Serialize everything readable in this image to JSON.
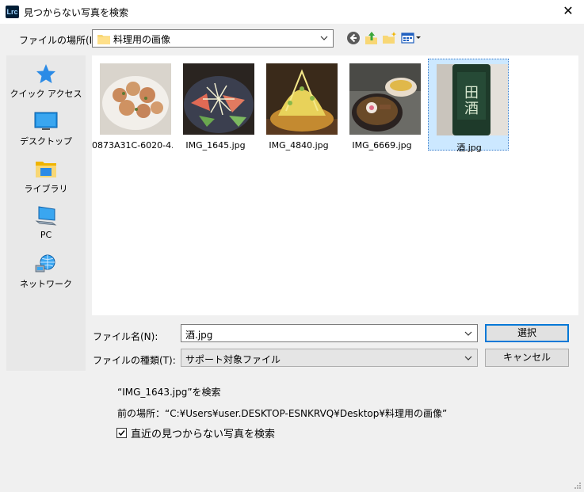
{
  "window": {
    "app_icon": "Lrc",
    "title": "見つからない写真を検索",
    "close_glyph": "✕"
  },
  "lookin": {
    "label": "ファイルの場所(I):",
    "value": "料理用の画像"
  },
  "places": [
    {
      "label": "クイック アクセス",
      "icon": "star-icon"
    },
    {
      "label": "デスクトップ",
      "icon": "desktop-icon"
    },
    {
      "label": "ライブラリ",
      "icon": "library-icon"
    },
    {
      "label": "PC",
      "icon": "pc-icon"
    },
    {
      "label": "ネットワーク",
      "icon": "network-icon"
    }
  ],
  "files": [
    {
      "name": "0873A31C-6020-4...",
      "selected": false
    },
    {
      "name": "IMG_1645.jpg",
      "selected": false
    },
    {
      "name": "IMG_4840.jpg",
      "selected": false
    },
    {
      "name": "IMG_6669.jpg",
      "selected": false
    },
    {
      "name": "酒.jpg",
      "selected": true
    }
  ],
  "filename": {
    "label": "ファイル名(N):",
    "value": "酒.jpg"
  },
  "filetype": {
    "label": "ファイルの種類(T):",
    "value": "サポート対象ファイル"
  },
  "buttons": {
    "select": "選択",
    "cancel": "キャンセル"
  },
  "info": {
    "searching": "“IMG_1643.jpg”を検索",
    "previous_location": "前の場所：“C:¥Users¥user.DESKTOP-ESNKRVQ¥Desktop¥料理用の画像”"
  },
  "checkbox": {
    "label": "直近の見つからない写真を検索",
    "checked": true
  },
  "colors": {
    "accent": "#0078d7",
    "selection": "#cce8ff"
  }
}
